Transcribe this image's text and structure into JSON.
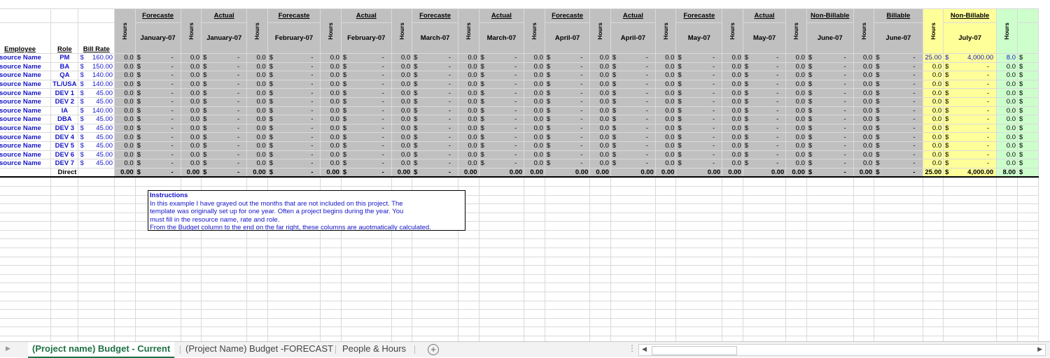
{
  "columns": {
    "employee": "Employee",
    "role": "Role",
    "bill_rate": "Bill Rate",
    "hours": "Hours"
  },
  "months": [
    {
      "type": "Forecaste",
      "month": "January-07",
      "shade": "gray"
    },
    {
      "type": "Actual",
      "month": "January-07",
      "shade": "gray"
    },
    {
      "type": "Forecaste",
      "month": "February-07",
      "shade": "gray"
    },
    {
      "type": "Actual",
      "month": "February-07",
      "shade": "gray"
    },
    {
      "type": "Forecaste",
      "month": "March-07",
      "shade": "gray"
    },
    {
      "type": "Actual",
      "month": "March-07",
      "shade": "gray"
    },
    {
      "type": "Forecaste",
      "month": "April-07",
      "shade": "gray"
    },
    {
      "type": "Actual",
      "month": "April-07",
      "shade": "gray"
    },
    {
      "type": "Forecaste",
      "month": "May-07",
      "shade": "gray"
    },
    {
      "type": "Actual",
      "month": "May-07",
      "shade": "gray"
    },
    {
      "type": "Non-Billable",
      "month": "June-07",
      "shade": "gray"
    },
    {
      "type": "Billable",
      "month": "June-07",
      "shade": "gray"
    },
    {
      "type": "Non-Billable",
      "month": "July-07",
      "shade": "yellow"
    }
  ],
  "employees": [
    {
      "name": "Resource Name",
      "role": "PM",
      "rate": "160.00"
    },
    {
      "name": "Resource Name",
      "role": "BA",
      "rate": "150.00"
    },
    {
      "name": "Resource Name",
      "role": "QA",
      "rate": "140.00"
    },
    {
      "name": "Resource Name",
      "role": "TL/USA",
      "rate": "140.00"
    },
    {
      "name": "Resource Name",
      "role": "DEV 1",
      "rate": "45.00"
    },
    {
      "name": "Resource Name",
      "role": "DEV 2",
      "rate": "45.00"
    },
    {
      "name": "Resource Name",
      "role": "IA",
      "rate": "140.00"
    },
    {
      "name": "Resource Name",
      "role": "DBA",
      "rate": "45.00"
    },
    {
      "name": "Resource Name",
      "role": "DEV 3",
      "rate": "45.00"
    },
    {
      "name": "Resource Name",
      "role": "DEV 4",
      "rate": "45.00"
    },
    {
      "name": "Resource Name",
      "role": "DEV 5",
      "rate": "45.00"
    },
    {
      "name": "Resource Name",
      "role": "DEV 6",
      "rate": "45.00"
    },
    {
      "name": "Resource Name",
      "role": "DEV 7",
      "rate": "45.00"
    }
  ],
  "cell_values": {
    "zero_hours": "0.0",
    "dollar": "$",
    "dash": "-",
    "july_pm_hours": "25.00",
    "july_pm_amount": "4,000.00",
    "green_first_hours": "8.0"
  },
  "totals": {
    "label": "Direct",
    "zero_hours": "0.00",
    "zero_amount": "0.00",
    "july_hours": "25.00",
    "july_amount": "4,000.00",
    "green_hours": "8.00"
  },
  "instructions": {
    "title": "Instructions",
    "lines": [
      "In this example I have grayed out the months that are not included on this project.  The",
      "template was originally set up for one year. Often a project begins during the year. You",
      "must fill in the resource name, rate and role.",
      "From the Budget column to the end on the far right, these columns are auotmatically calculated."
    ]
  },
  "tabs": {
    "sheet1": "(Project name) Budget - Current",
    "sheet2": "(Project Name) Budget -FORECAST",
    "sheet3": "People & Hours",
    "add": "+"
  },
  "colors": {
    "gray": "#c0c0c0",
    "yellow": "#ffff99",
    "green": "#ccffcc",
    "blue_text": "#1515c8",
    "active_tab": "#1e7145"
  }
}
